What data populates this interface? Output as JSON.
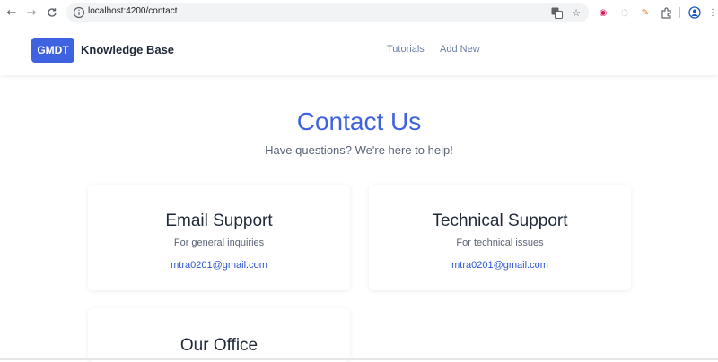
{
  "browser": {
    "url": "localhost:4200/contact",
    "back_icon": "arrow-left-icon",
    "forward_icon": "arrow-right-icon",
    "reload_icon": "reload-icon"
  },
  "header": {
    "logo_text": "GMDT",
    "brand": "Knowledge Base",
    "nav": [
      {
        "label": "Tutorials"
      },
      {
        "label": "Add New"
      }
    ]
  },
  "main": {
    "title": "Contact Us",
    "subtitle": "Have questions? We're here to help!",
    "cards": [
      {
        "title": "Email Support",
        "description": "For general inquiries",
        "email": "mtra0201@gmail.com"
      },
      {
        "title": "Technical Support",
        "description": "For technical issues",
        "email": "mtra0201@gmail.com"
      },
      {
        "title": "Our Office"
      }
    ]
  },
  "colors": {
    "accent": "#3f63e0",
    "link": "#2f55d4",
    "nav_text": "#6b7ea3"
  }
}
